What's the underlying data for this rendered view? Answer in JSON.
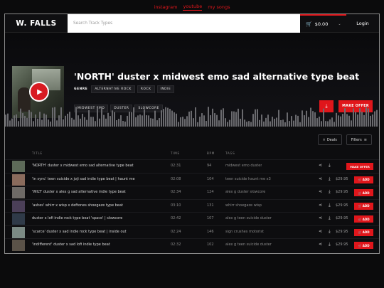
{
  "top_links": [
    "instagram",
    "youtube",
    "my songs"
  ],
  "header": {
    "logo": "W. FALLS",
    "search_placeholder": "Search Track Types",
    "cart_total": "$0.00",
    "login": "Login"
  },
  "hero": {
    "title": "'NORTH' duster x midwest emo sad alternative type beat",
    "genre_label": "GENRE",
    "genres": [
      "ALTERNATIVE ROCK",
      "ROCK",
      "INDIE"
    ],
    "tags": [
      "MIDWEST EMO",
      "DUSTER",
      "SLOWCORE"
    ],
    "make_offer": "MAKE OFFER"
  },
  "filters": {
    "deals": "Deals",
    "filters": "Filters"
  },
  "table_headers": {
    "title": "TITLE",
    "time": "TIME",
    "bpm": "BPM",
    "tags": "TAGS"
  },
  "tracks": [
    {
      "title": "'NORTH' duster x midwest emo sad alternative type beat",
      "time": "02:31",
      "bpm": "94",
      "tags": "midwest emo  duster",
      "price": "",
      "action": "MAKE OFFER",
      "thumb": "#5d6a58"
    },
    {
      "title": "'in sync' teen suicide x joji sad indie type beat | haunt me",
      "time": "02:08",
      "bpm": "104",
      "tags": "teen suicide  haunt me x3",
      "price": "$29.95",
      "action": "ADD",
      "thumb": "#8a6b5c"
    },
    {
      "title": "'WILT' duster x alex g sad alternative indie type beat",
      "time": "02:34",
      "bpm": "124",
      "tags": "alex g  duster  slowcore",
      "price": "$29.95",
      "action": "ADD",
      "thumb": "#6e6a66"
    },
    {
      "title": "'ashes' whirr x wisp x deftones shoegaze type beat",
      "time": "03:10",
      "bpm": "131",
      "tags": "whirr  shoegaze  wisp",
      "price": "$29.95",
      "action": "ADD",
      "thumb": "#4b3f58"
    },
    {
      "title": "duster x lofi indie rock type beat 'space' | slowcore",
      "time": "02:42",
      "bpm": "107",
      "tags": "alex g  teen suicide  duster",
      "price": "$29.95",
      "action": "ADD",
      "thumb": "#2f3a48"
    },
    {
      "title": "'scarce' duster x sad indie rock type beat | inside out",
      "time": "02:24",
      "bpm": "146",
      "tags": "sign crushes motorist",
      "price": "$29.95",
      "action": "ADD",
      "thumb": "#7b8a84"
    },
    {
      "title": "'indifferent' duster x sad lofi indie type beat",
      "time": "02:32",
      "bpm": "102",
      "tags": "alex g  teen suicide  duster",
      "price": "$29.95",
      "action": "ADD",
      "thumb": "#5a5248"
    }
  ],
  "icons": {
    "cart": "cart-icon",
    "share": "share-icon",
    "download": "download-icon",
    "play": "play-icon",
    "tag": "tag-icon",
    "filter": "filter-icon"
  },
  "colors": {
    "accent": "#e0161b",
    "background": "#0c0c0e"
  }
}
